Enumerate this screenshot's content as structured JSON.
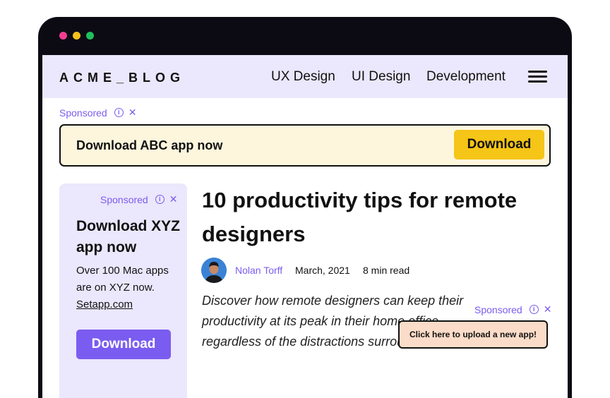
{
  "nav": {
    "logo": "ACME_BLOG",
    "links": [
      "UX Design",
      "UI Design",
      "Development"
    ]
  },
  "top_ad": {
    "sponsored": "Sponsored",
    "text": "Download ABC app now",
    "button": "Download"
  },
  "side_ad": {
    "sponsored": "Sponsored",
    "title": "Download XYZ app now",
    "body": "Over 100 Mac apps are on XYZ now.",
    "link": "Setapp.com",
    "button": "Download"
  },
  "article": {
    "title": "10 productivity tips for remote designers",
    "author": "Nolan Torff",
    "date": "March, 2021",
    "read_time": "8 min read",
    "excerpt": "Discover how remote designers can keep their productivity at its peak in their home office — regardless of the distractions surrounding them."
  },
  "float_ad": {
    "sponsored": "Sponsored",
    "button": "Click here to upload a new app!"
  },
  "colors": {
    "accent": "#7b5cf0",
    "nav_bg": "#ebe7fc",
    "banner_bg": "#fdf6dd",
    "banner_button": "#f5c517",
    "float_ad_bg": "#fbdcc8"
  }
}
